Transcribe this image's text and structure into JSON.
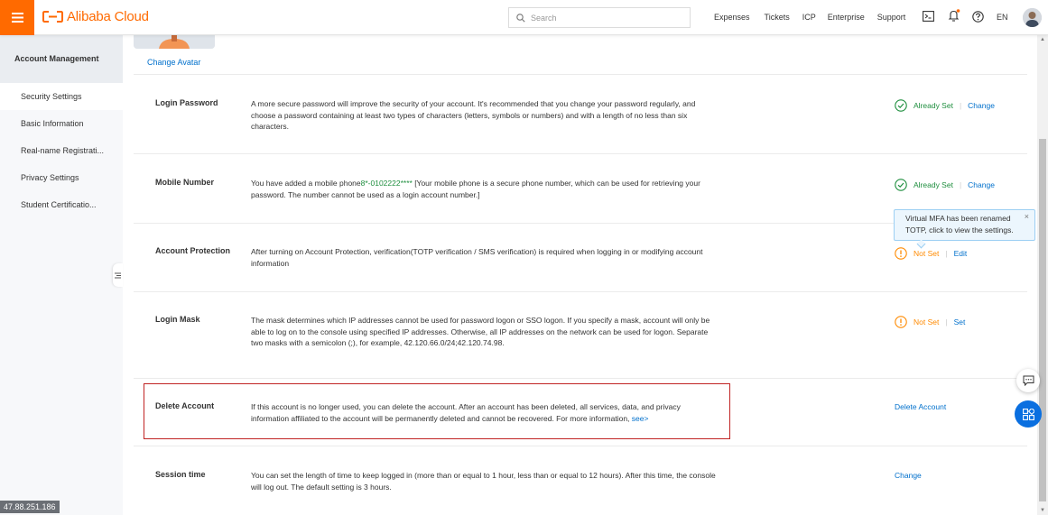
{
  "header": {
    "logo_text": "Alibaba Cloud",
    "search_placeholder": "Search",
    "nav": [
      "Expenses",
      "Tickets",
      "ICP",
      "Enterprise",
      "Support"
    ],
    "language": "EN",
    "brand_color": "#ff6a00"
  },
  "sidebar": {
    "title": "Account Management",
    "items": [
      {
        "label": "Security Settings",
        "active": true
      },
      {
        "label": "Basic Information",
        "active": false
      },
      {
        "label": "Real-name Registrati...",
        "active": false
      },
      {
        "label": "Privacy Settings",
        "active": false
      },
      {
        "label": "Student Certificatio...",
        "active": false
      }
    ],
    "ip_address": "47.88.251.186"
  },
  "main": {
    "change_avatar": "Change Avatar",
    "rows": [
      {
        "title": "Login Password",
        "description": "A more secure password will improve the security of your account. It's recommended that you change your password regularly, and choose a password containing at least two types of characters (letters, symbols or numbers) and with a length of no less than six characters.",
        "status": "Already Set",
        "action": "Change"
      },
      {
        "title": "Mobile Number",
        "desc_prefix": "You have added a mobile phone",
        "phone": "8*-0102222****",
        "desc_suffix": " [Your mobile phone is a secure phone number, which can be used for retrieving your password. The number cannot be used as a login account number.]",
        "status": "Already Set",
        "action": "Change"
      },
      {
        "title": "Account Protection",
        "description": "After turning on Account Protection, verification(TOTP verification / SMS verification) is required when logging in or modifying account information",
        "status": "Not Set",
        "action": "Edit"
      },
      {
        "title": "Login Mask",
        "description": "The mask determines which IP addresses cannot be used for password logon or SSO logon. If you specify a mask, account will only be able to log on to the console using specified IP addresses. Otherwise, all IP addresses on the network can be used for logon. Separate two masks with a semicolon (;), for example, 42.120.66.0/24;42.120.74.98.",
        "status": "Not Set",
        "action": "Set"
      },
      {
        "title": "Delete Account",
        "description": "If this account is no longer used, you can delete the account. After an account has been deleted, all services, data, and privacy information affiliated to the account will be permanently deleted and cannot be recovered. For more information, ",
        "link": "see>",
        "action": "Delete Account"
      },
      {
        "title": "Session time",
        "description": "You can set the length of time to keep logged in (more than or equal to 1 hour, less than or equal to 12 hours). After this time, the console will log out. The default setting is 3 hours.",
        "action": "Change"
      }
    ],
    "tooltip": {
      "text": "Virtual MFA has been renamed TOTP, click to view the settings.",
      "close": "×"
    }
  },
  "colors": {
    "ok": "#1e8e3e",
    "warn": "#ff8a00",
    "link": "#0070cc",
    "highlight_border": "#c02424"
  }
}
